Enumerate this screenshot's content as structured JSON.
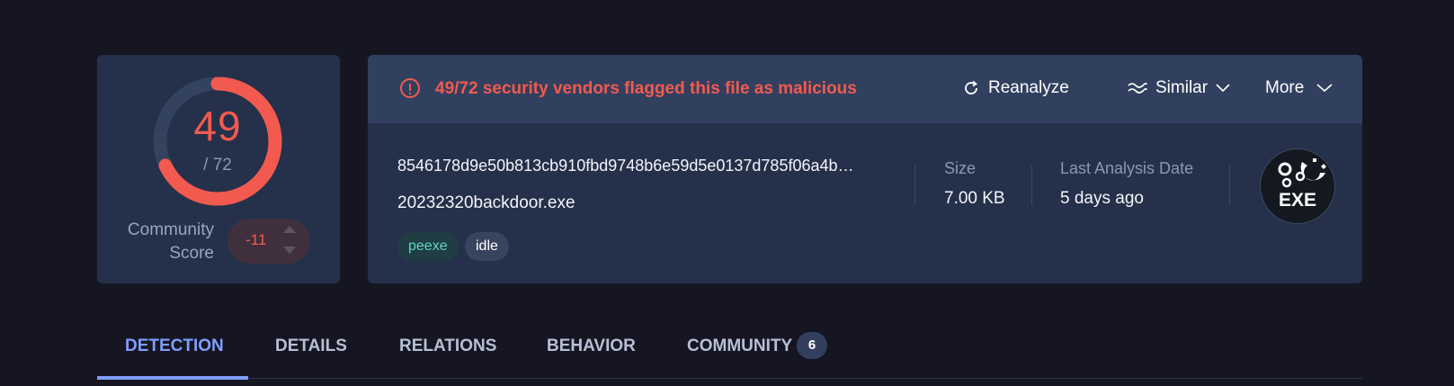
{
  "score": {
    "detected": "49",
    "total": "/ 72",
    "detected_fraction": 0.6806,
    "community_label_line1": "Community",
    "community_label_line2": "Score",
    "community_value": "-11"
  },
  "alert": {
    "text": "49/72 security vendors flagged this file as malicious",
    "color": "#f25a4f",
    "icon": "alert-circle-icon"
  },
  "actions": {
    "reanalyze": "Reanalyze",
    "similar": "Similar",
    "more": "More"
  },
  "file": {
    "hash": "8546178d9e50b813cb910fbd9748b6e59d5e0137d785f06a4b…",
    "name": "20232320backdoor.exe",
    "tags": [
      "peexe",
      "idle"
    ],
    "size_label": "Size",
    "size_value": "7.00 KB",
    "date_label": "Last Analysis Date",
    "date_value": "5 days ago",
    "type_badge": "EXE"
  },
  "tabs": [
    {
      "label": "DETECTION",
      "active": true
    },
    {
      "label": "DETAILS",
      "active": false
    },
    {
      "label": "RELATIONS",
      "active": false
    },
    {
      "label": "BEHAVIOR",
      "active": false
    },
    {
      "label": "COMMUNITY",
      "active": false,
      "count": "6"
    }
  ]
}
